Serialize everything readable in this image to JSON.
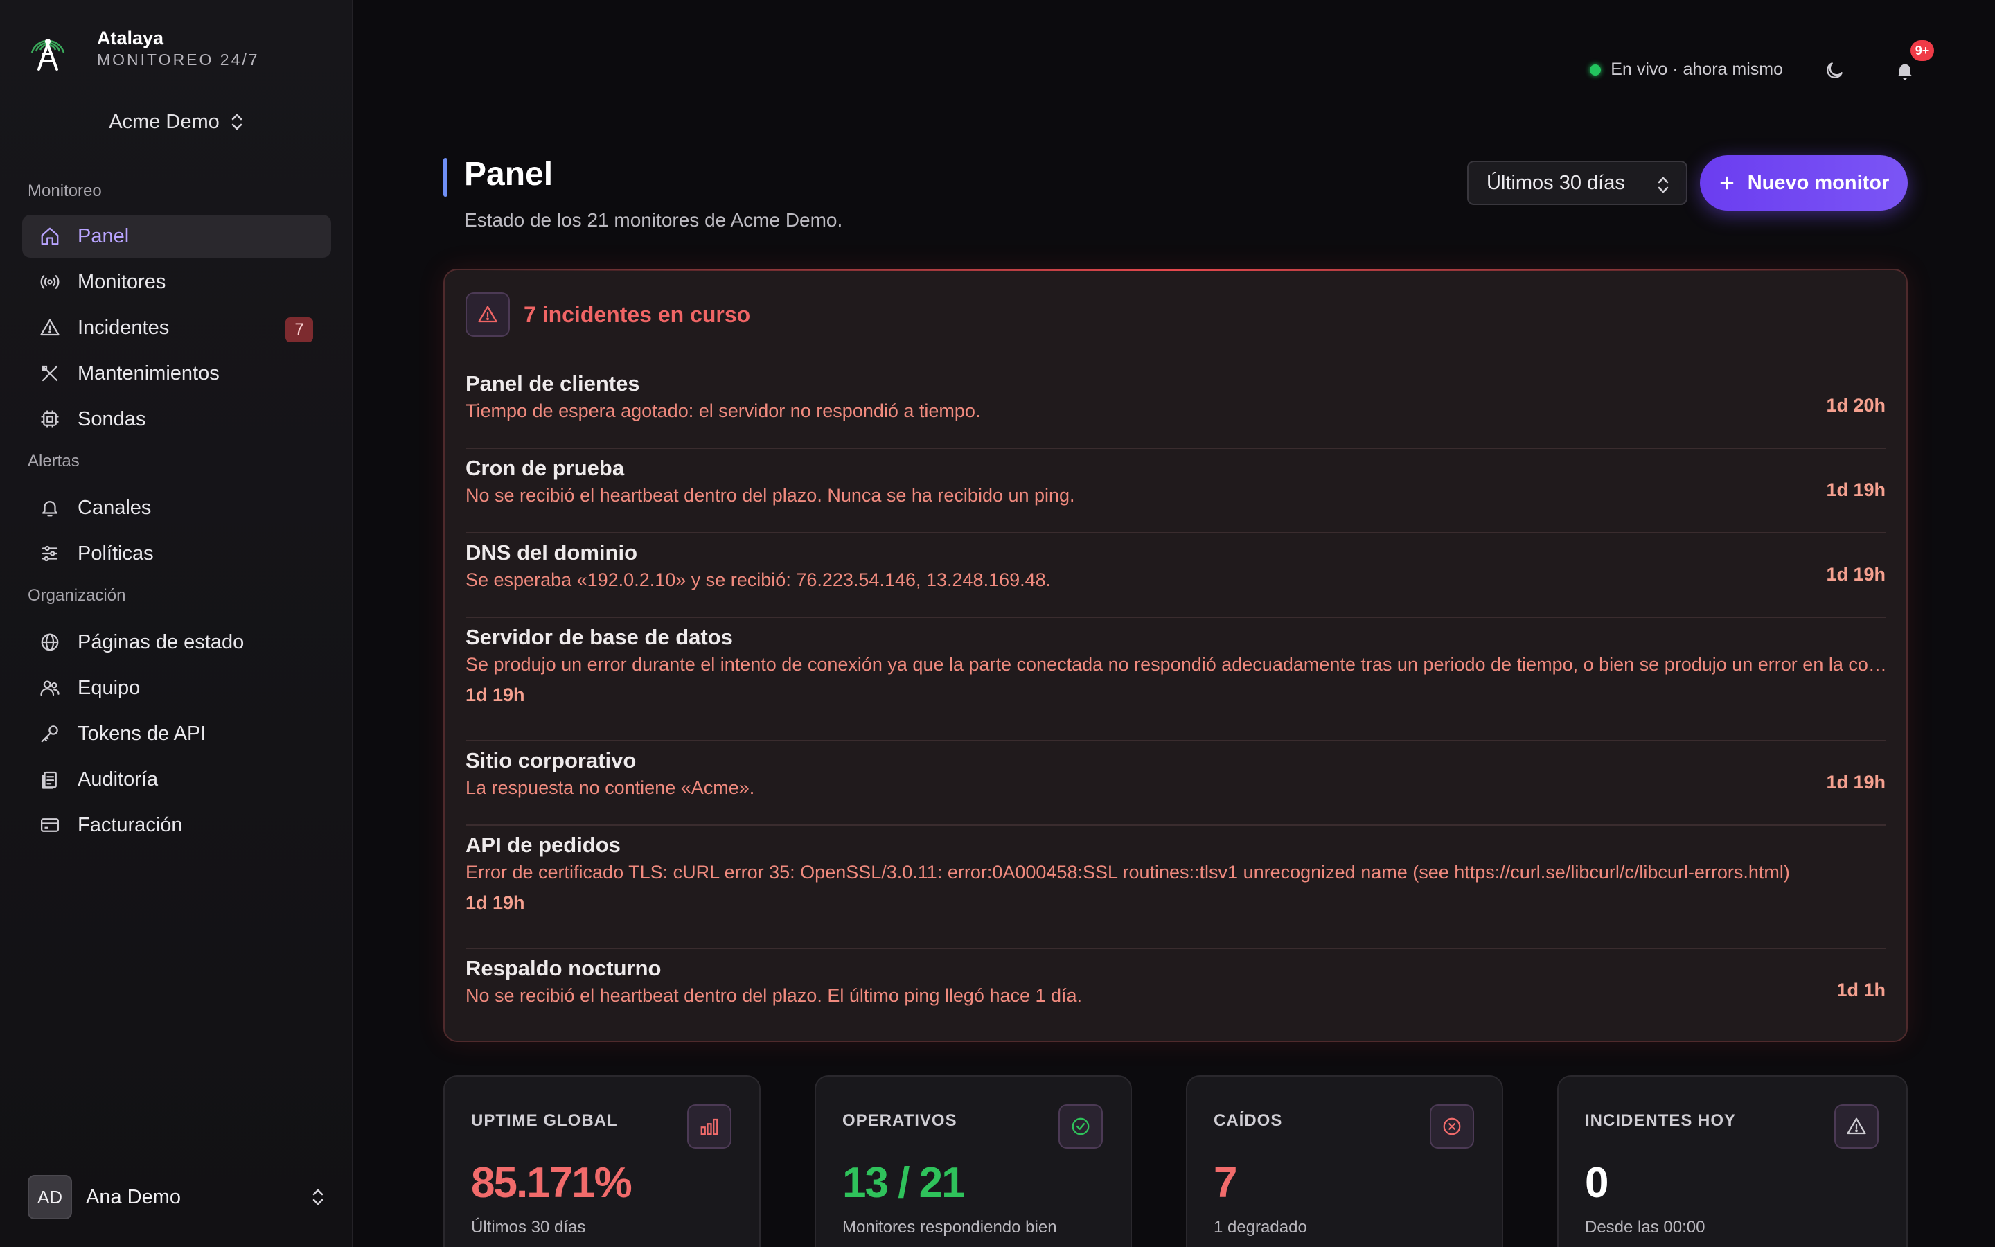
{
  "brand": {
    "name": "Atalaya",
    "tagline": "MONITOREO 24/7"
  },
  "org": {
    "name": "Acme Demo"
  },
  "nav": {
    "sections": [
      {
        "label": "Monitoreo"
      },
      {
        "label": "Alertas"
      },
      {
        "label": "Organización"
      }
    ],
    "items": [
      {
        "label": "Panel",
        "icon": "home-icon",
        "active": true
      },
      {
        "label": "Monitores",
        "icon": "broadcast-icon"
      },
      {
        "label": "Incidentes",
        "icon": "alert-triangle-icon",
        "badge": "7"
      },
      {
        "label": "Mantenimientos",
        "icon": "tools-icon"
      },
      {
        "label": "Sondas",
        "icon": "chip-icon"
      },
      {
        "label": "Canales",
        "icon": "bell-icon"
      },
      {
        "label": "Políticas",
        "icon": "sliders-icon"
      },
      {
        "label": "Páginas de estado",
        "icon": "globe-icon"
      },
      {
        "label": "Equipo",
        "icon": "users-icon"
      },
      {
        "label": "Tokens de API",
        "icon": "key-icon"
      },
      {
        "label": "Auditoría",
        "icon": "clipboard-icon"
      },
      {
        "label": "Facturación",
        "icon": "card-icon"
      }
    ]
  },
  "user": {
    "initials": "AD",
    "name": "Ana Demo"
  },
  "header": {
    "live_status": "En vivo · ahora mismo",
    "notifications_badge": "9+"
  },
  "page": {
    "title": "Panel",
    "subtitle": "Estado de los 21 monitores de Acme Demo.",
    "range_label": "Últimos 30 días",
    "new_button": "Nuevo monitor"
  },
  "incidents": {
    "title": "7 incidentes en curso",
    "items": [
      {
        "name": "Panel de clientes",
        "description": "Tiempo de espera agotado: el servidor no respondió a tiempo.",
        "duration": "1d 20h"
      },
      {
        "name": "Cron de prueba",
        "description": "No se recibió el heartbeat dentro del plazo. Nunca se ha recibido un ping.",
        "duration": "1d 19h"
      },
      {
        "name": "DNS del dominio",
        "description": "Se esperaba «192.0.2.10» y se recibió: 76.223.54.146, 13.248.169.48.",
        "duration": "1d 19h"
      },
      {
        "name": "Servidor de base de datos",
        "description": "Se produjo un error durante el intento de conexión ya que la parte conectada no respondió adecuadamente tras un periodo de tiempo, o bien se produjo un error en la conexión establecida ya que el host conectado no ha podido responder.",
        "duration": "1d 19h"
      },
      {
        "name": "Sitio corporativo",
        "description": "La respuesta no contiene «Acme».",
        "duration": "1d 19h"
      },
      {
        "name": "API de pedidos",
        "description": "Error de certificado TLS: cURL error 35: OpenSSL/3.0.11: error:0A000458:SSL routines::tlsv1 unrecognized name (see https://curl.se/libcurl/c/libcurl-errors.html)",
        "duration": "1d 19h"
      },
      {
        "name": "Respaldo nocturno",
        "description": "No se recibió el heartbeat dentro del plazo. El último ping llegó hace 1 día.",
        "duration": "1d 1h"
      }
    ]
  },
  "stats": [
    {
      "label": "UPTIME GLOBAL",
      "value": "85.171%",
      "caption": "Últimos 30 días",
      "icon": "bar-chart-icon",
      "color": "#f16b6b"
    },
    {
      "label": "OPERATIVOS",
      "value": "13 / 21",
      "caption": "Monitores respondiendo bien",
      "icon": "check-circle-icon",
      "color": "#2fc25b"
    },
    {
      "label": "CAÍDOS",
      "value": "7",
      "caption": "1 degradado",
      "icon": "x-circle-icon",
      "color": "#f16b6b"
    },
    {
      "label": "INCIDENTES HOY",
      "value": "0",
      "caption": "Desde las 00:00",
      "icon": "alert-triangle-icon",
      "color": "#ffffff"
    }
  ],
  "colors": {
    "accent": "#7b55f5",
    "danger": "#f06565",
    "success": "#2fc25b",
    "live": "#22c55e"
  }
}
